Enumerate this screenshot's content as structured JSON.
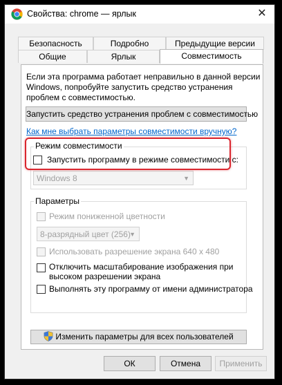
{
  "window": {
    "title": "Свойства: chrome — ярлык",
    "close_glyph": "✕",
    "app_icon": "chrome-icon"
  },
  "tabs": {
    "row1": [
      "Безопасность",
      "Подробно",
      "Предыдущие версии"
    ],
    "row2": [
      "Общие",
      "Ярлык",
      "Совместимость"
    ],
    "active": "Совместимость"
  },
  "intro": {
    "line1": "Если эта программа работает неправильно в данной версии",
    "line2": "Windows, попробуйте запустить средство устранения",
    "line3": "проблем с совместимостью."
  },
  "troubleshooter_button": "Запустить средство устранения проблем с совместимостью",
  "manual_link": "Как мне выбрать параметры совместимости вручную?",
  "compat_mode": {
    "legend": "Режим совместимости",
    "checkbox_label": "Запустить программу в режиме совместимости с:",
    "checked": false,
    "os_select": "Windows 8"
  },
  "params": {
    "legend": "Параметры",
    "reduced_color": "Режим пониженной цветности",
    "color_select": "8-разрядный цвет (256)",
    "resolution": "Использовать разрешение экрана 640 x 480",
    "disable_scaling_line1": "Отключить масштабирование изображения при",
    "disable_scaling_line2": "высоком разрешении экрана",
    "run_as_admin": "Выполнять эту программу от имени администратора"
  },
  "all_users_button": "Изменить параметры для всех пользователей",
  "footer": {
    "ok": "ОК",
    "cancel": "Отмена",
    "apply": "Применить"
  },
  "colors": {
    "highlight": "#d9262e",
    "link": "#0066cc",
    "disabled": "#a0a0a0"
  }
}
